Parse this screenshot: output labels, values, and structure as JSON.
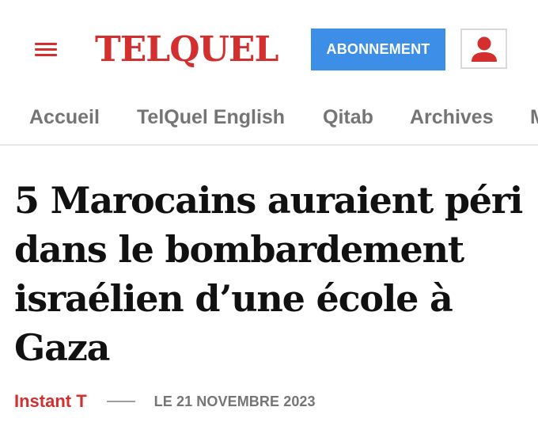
{
  "header": {
    "logo_text": "TELQUEL",
    "subscribe_label": "ABONNEMENT",
    "menu_icon": "hamburger-menu-icon",
    "account_icon": "user-icon"
  },
  "nav": {
    "items": [
      {
        "label": "Accueil"
      },
      {
        "label": "TelQuel English"
      },
      {
        "label": "Qitab"
      },
      {
        "label": "Archives"
      },
      {
        "label": "M"
      }
    ]
  },
  "article": {
    "title": "5 Marocains auraient péri dans le bombardement israélien d’une école à Gaza",
    "author": "Instant T",
    "date": "LE 21 NOVEMBRE 2023"
  },
  "colors": {
    "brand_red": "#d32f2f",
    "subscribe_blue": "#3d8ee6",
    "nav_gray": "#757575"
  }
}
